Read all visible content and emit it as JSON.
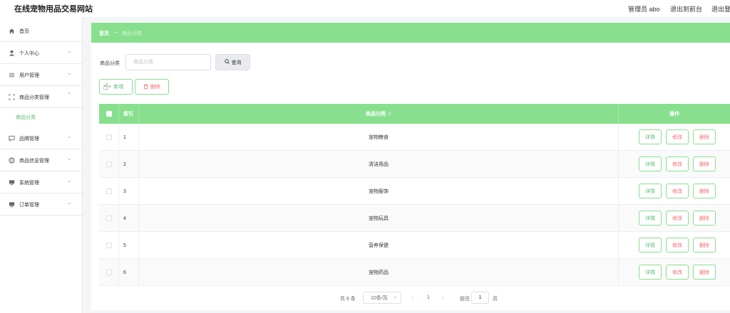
{
  "header": {
    "site_title": "在线宠物用品交易网站",
    "role_user": "管理员 abo",
    "back_to_front": "退出到前台",
    "logout": "退出登"
  },
  "sidebar": {
    "items": [
      {
        "label": "首页",
        "icon": "home-icon",
        "has_chevron": false
      },
      {
        "label": "个人中心",
        "icon": "user-icon",
        "has_chevron": true
      },
      {
        "label": "用户管理",
        "icon": "list-icon",
        "has_chevron": true
      },
      {
        "label": "商品分类管理",
        "icon": "scan-icon",
        "has_chevron": true,
        "expanded": true
      },
      {
        "label": "品牌管理",
        "icon": "chat-icon",
        "has_chevron": true
      },
      {
        "label": "商品信息管理",
        "icon": "globe-icon",
        "has_chevron": true
      },
      {
        "label": "系统管理",
        "icon": "monitor-icon",
        "has_chevron": true
      },
      {
        "label": "订单管理",
        "icon": "monitor-icon",
        "has_chevron": true
      }
    ],
    "active_sub": "商品分类"
  },
  "breadcrumb": {
    "home": "首页",
    "current": "商品分类"
  },
  "search": {
    "label": "商品分类",
    "placeholder": "商品分类",
    "query_label": "查询"
  },
  "actions": {
    "add_label": "新增",
    "delete_label": "删除"
  },
  "table": {
    "headers": {
      "index": "索引",
      "category": "商品分类",
      "ops": "操作"
    },
    "rows": [
      {
        "index": "1",
        "category": "宠物粮食"
      },
      {
        "index": "2",
        "category": "清洁用品"
      },
      {
        "index": "3",
        "category": "宠物服饰"
      },
      {
        "index": "4",
        "category": "宠物玩具"
      },
      {
        "index": "5",
        "category": "营养保健"
      },
      {
        "index": "6",
        "category": "宠物药品"
      }
    ],
    "row_actions": {
      "detail": "详情",
      "edit": "修改",
      "remove": "删除"
    }
  },
  "pagination": {
    "total": "共 6 条",
    "page_size": "10条/页",
    "current_page": "1",
    "goto_label": "前往",
    "goto_value": "1",
    "page_unit": "页"
  },
  "colors": {
    "accent": "#88e08e",
    "accent_text": "#5bbd6e",
    "danger": "#f56c6c"
  }
}
